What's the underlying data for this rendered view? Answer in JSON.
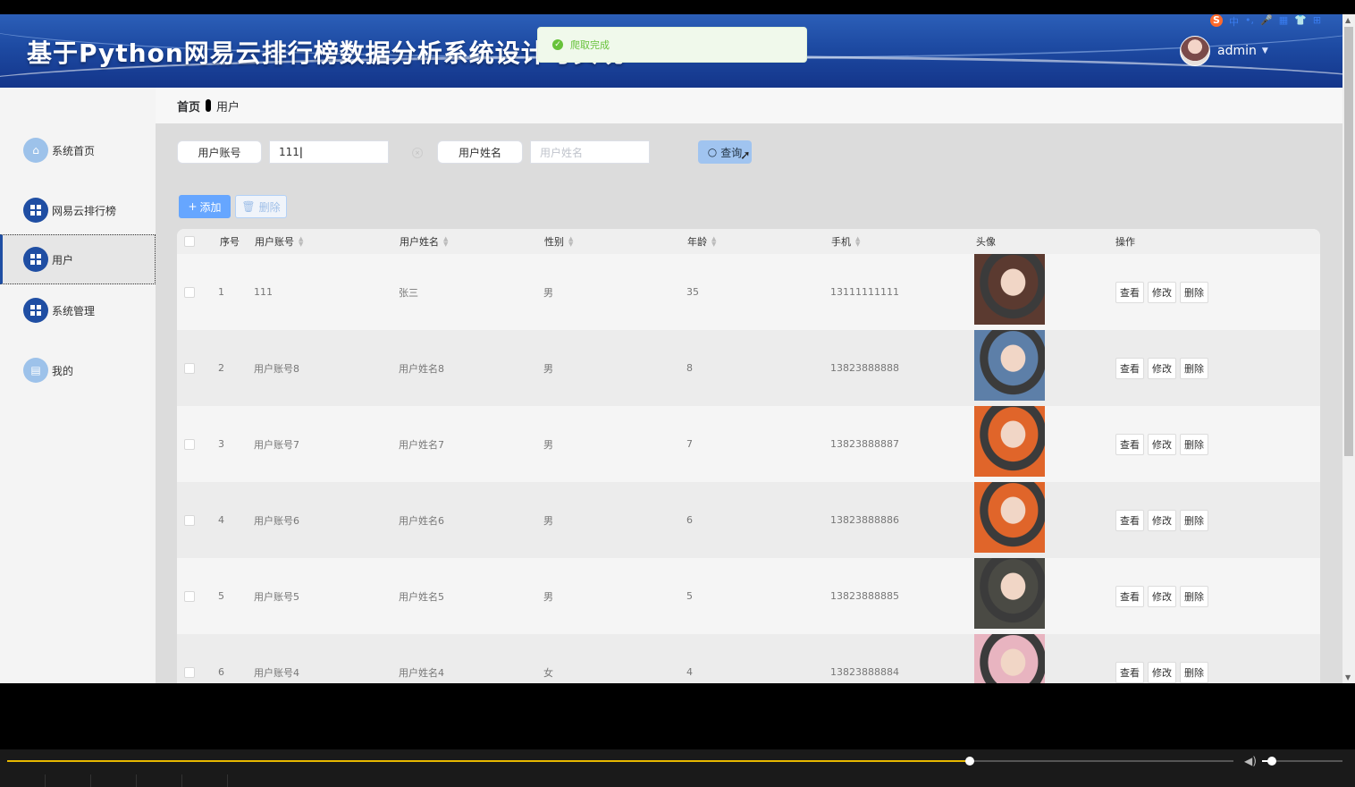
{
  "header": {
    "title": "基于Python网易云排行榜数据分析系统设计与实现",
    "username": "admin",
    "tray": [
      "中",
      "•,",
      "🎤",
      "▦",
      "👕",
      "⊞"
    ]
  },
  "toast": {
    "message": "爬取完成"
  },
  "breadcrumb": {
    "home": "首页",
    "current": "用户"
  },
  "sidebar": {
    "items": [
      {
        "label": "系统首页",
        "icon": "home-icon"
      },
      {
        "label": "网易云排行榜",
        "icon": "grid-icon"
      },
      {
        "label": "用户",
        "icon": "grid-icon",
        "active": true
      },
      {
        "label": "系统管理",
        "icon": "grid-icon"
      },
      {
        "label": "我的",
        "icon": "card-icon"
      }
    ]
  },
  "search": {
    "account_label": "用户账号",
    "account_value": "111",
    "name_label": "用户姓名",
    "name_placeholder": "用户姓名",
    "query_label": "查询"
  },
  "actions": {
    "add_label": "添加",
    "delete_label": "删除"
  },
  "table": {
    "headers": [
      "序号",
      "用户账号",
      "用户姓名",
      "性别",
      "年龄",
      "手机",
      "头像",
      "操作"
    ],
    "op_labels": [
      "查看",
      "修改",
      "删除"
    ],
    "rows": [
      {
        "index": "1",
        "account": "111",
        "name": "张三",
        "gender": "男",
        "age": "35",
        "phone": "13111111111",
        "avatar_color": "#5b3a30"
      },
      {
        "index": "2",
        "account": "用户账号8",
        "name": "用户姓名8",
        "gender": "男",
        "age": "8",
        "phone": "13823888888",
        "avatar_color": "#5d7fa8"
      },
      {
        "index": "3",
        "account": "用户账号7",
        "name": "用户姓名7",
        "gender": "男",
        "age": "7",
        "phone": "13823888887",
        "avatar_color": "#e0652a"
      },
      {
        "index": "4",
        "account": "用户账号6",
        "name": "用户姓名6",
        "gender": "男",
        "age": "6",
        "phone": "13823888886",
        "avatar_color": "#e0652a"
      },
      {
        "index": "5",
        "account": "用户账号5",
        "name": "用户姓名5",
        "gender": "男",
        "age": "5",
        "phone": "13823888885",
        "avatar_color": "#4a4a44"
      },
      {
        "index": "6",
        "account": "用户账号4",
        "name": "用户姓名4",
        "gender": "女",
        "age": "4",
        "phone": "13823888884",
        "avatar_color": "#e8b4c0"
      }
    ]
  },
  "player": {
    "progress": 0.785,
    "volume": 0.12
  }
}
